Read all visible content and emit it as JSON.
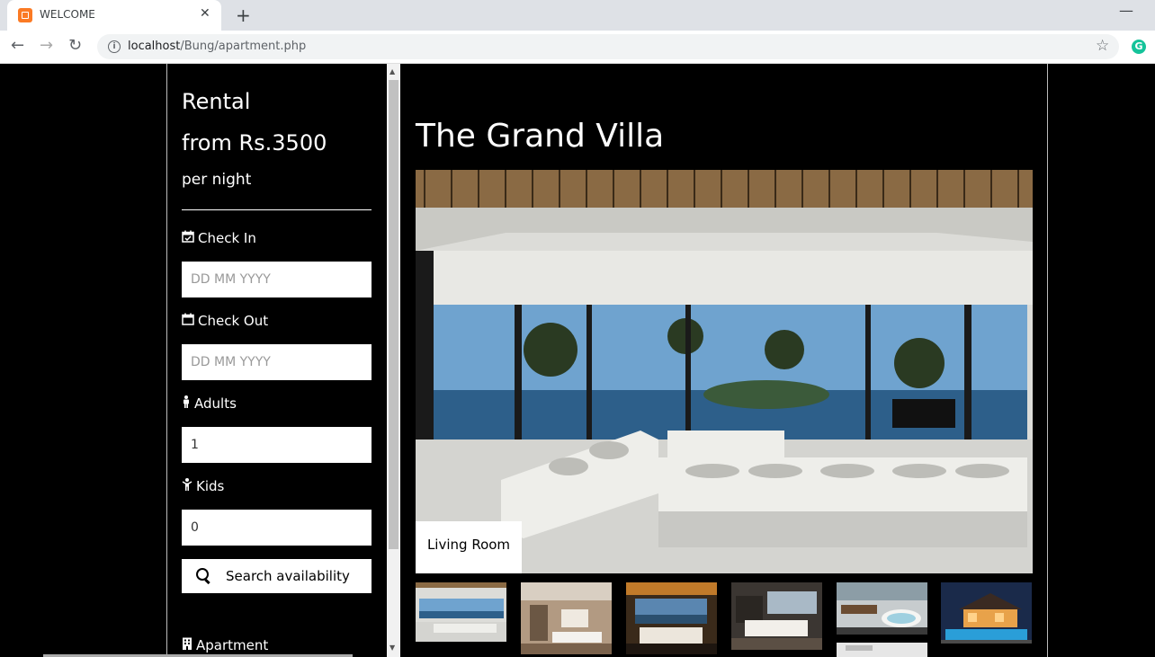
{
  "browser": {
    "tab_title": "WELCOME",
    "url_host": "localhost",
    "url_path": "/Bung/apartment.php",
    "new_tab": "+",
    "close": "✕",
    "minimize": "—",
    "back": "←",
    "forward": "→",
    "reload": "↻",
    "star": "☆",
    "info": "i",
    "extension": "G"
  },
  "sidebar": {
    "title": "Rental",
    "price": "from Rs.3500",
    "unit": "per night",
    "check_in_label": "Check In",
    "check_in_placeholder": "DD MM YYYY",
    "check_out_label": "Check Out",
    "check_out_placeholder": "DD MM YYYY",
    "adults_label": "Adults",
    "adults_value": "1",
    "kids_label": "Kids",
    "kids_value": "0",
    "search_label": "Search availability",
    "apartment_label": "Apartment"
  },
  "main": {
    "title": "The Grand Villa",
    "caption": "Living Room",
    "thumbnails": [
      "living-room",
      "kitchen-dining",
      "bedroom-view",
      "bedroom",
      "bathroom",
      "exterior-pool"
    ]
  }
}
